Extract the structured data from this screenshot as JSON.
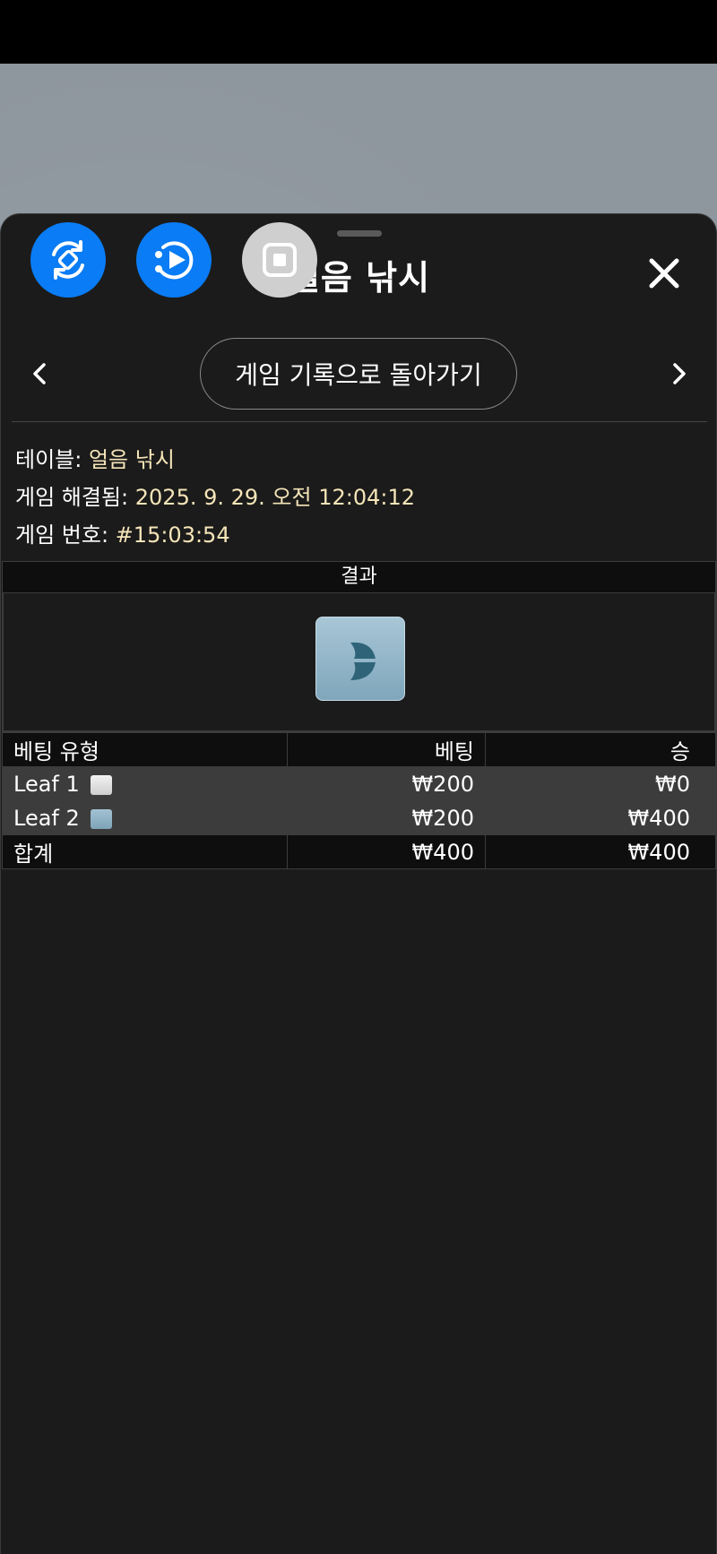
{
  "header": {
    "title": "얼음 낚시"
  },
  "nav": {
    "back_label": "게임 기록으로 돌아가기"
  },
  "info": {
    "table_label": "테이블:",
    "table_value": "얼음 낚시",
    "resolved_label": "게임 해결됨:",
    "resolved_value": "2025. 9. 29. 오전 12:04:12",
    "number_label": "게임 번호:",
    "number_value": "#15:03:54"
  },
  "result": {
    "header": "결과"
  },
  "bets": {
    "columns": [
      "베팅 유형",
      "베팅",
      "승"
    ],
    "rows": [
      {
        "type": "Leaf 1",
        "bet": "₩200",
        "win": "₩0",
        "icon": "white-leaf-tile"
      },
      {
        "type": "Leaf 2",
        "bet": "₩200",
        "win": "₩400",
        "icon": "blue-leaf-tile"
      }
    ],
    "total": {
      "label": "합계",
      "bet": "₩400",
      "win": "₩400"
    }
  },
  "overlay_buttons": [
    "rotate-icon",
    "replay-icon",
    "stop-icon"
  ],
  "colors": {
    "accent": "#0a7cf5",
    "value_text": "#f5e5b8",
    "sheet_bg": "#1b1b1b"
  }
}
